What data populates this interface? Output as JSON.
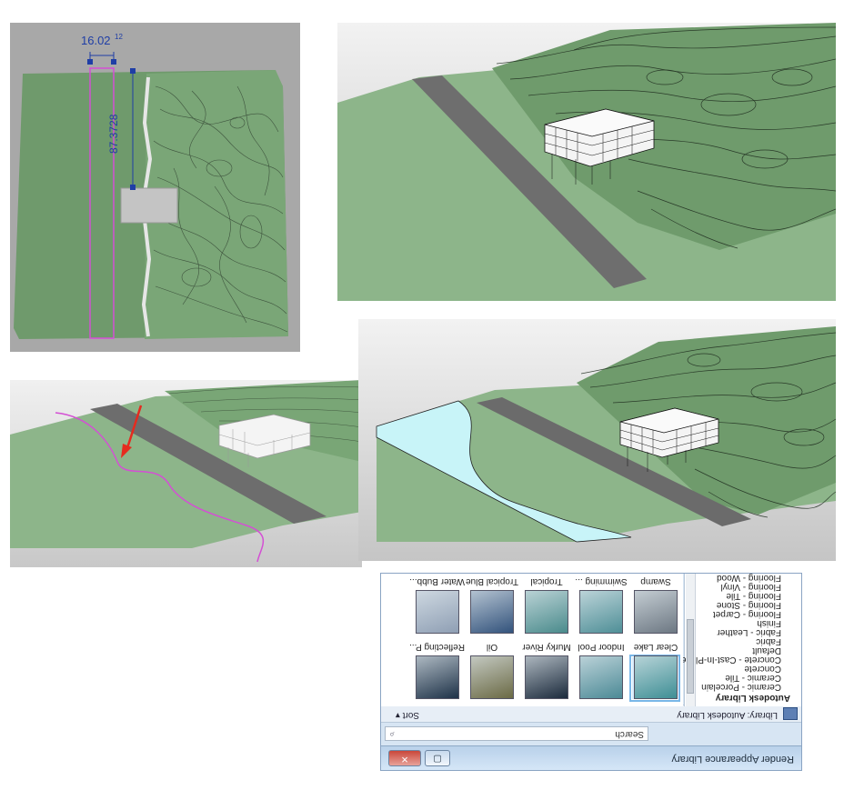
{
  "plan_view": {
    "dimension_horizontal": "16.02",
    "dimension_horizontal_sup": "12",
    "dimension_vertical": "87.3728"
  },
  "dialog": {
    "title": "Render Appearance Library",
    "minimize": "▢",
    "close": "✕",
    "search_placeholder": "Search",
    "library_label": "Library: Autodesk Library",
    "sort_label": "Sort ▾",
    "categories": [
      {
        "label": "Autodesk Library",
        "header": true
      },
      {
        "label": "Ceramic - Porcelain"
      },
      {
        "label": "Ceramic - Tile"
      },
      {
        "label": "Concrete"
      },
      {
        "label": "Concrete - Cast-In-Place"
      },
      {
        "label": "Default"
      },
      {
        "label": "Fabric"
      },
      {
        "label": "Fabric - Leather"
      },
      {
        "label": "Finish"
      },
      {
        "label": "Flooring - Carpet"
      },
      {
        "label": "Flooring - Stone"
      },
      {
        "label": "Flooring - Tile"
      },
      {
        "label": "Flooring - Vinyl"
      },
      {
        "label": "Flooring - Wood"
      }
    ],
    "materials_row1": [
      {
        "label": "Clear Lake",
        "color": "#3f8f95",
        "selected": true
      },
      {
        "label": "Indoor Pool",
        "color": "#4c8a96"
      },
      {
        "label": "Murky River",
        "color": "#1b2a3c"
      },
      {
        "label": "Oil",
        "color": "#6b6a45"
      },
      {
        "label": "Reflecting P...",
        "color": "#1e3248"
      }
    ],
    "materials_row2": [
      {
        "label": "Swamp",
        "color": "#6d7883"
      },
      {
        "label": "Swimming ...",
        "color": "#4f8f97"
      },
      {
        "label": "Tropical",
        "color": "#4a8b8c"
      },
      {
        "label": "Tropical Blue",
        "color": "#33537c"
      },
      {
        "label": "Water Bubb...",
        "color": "#8f9fb4"
      }
    ]
  },
  "colors": {
    "terrain": "#7ea57b",
    "terrain_dark": "#567c55",
    "road": "#6b6b6b",
    "water": "#c8f4f8",
    "pink": "#d44fd4",
    "arrow": "#e52b1f",
    "dim_blue": "#1f3ea6"
  }
}
